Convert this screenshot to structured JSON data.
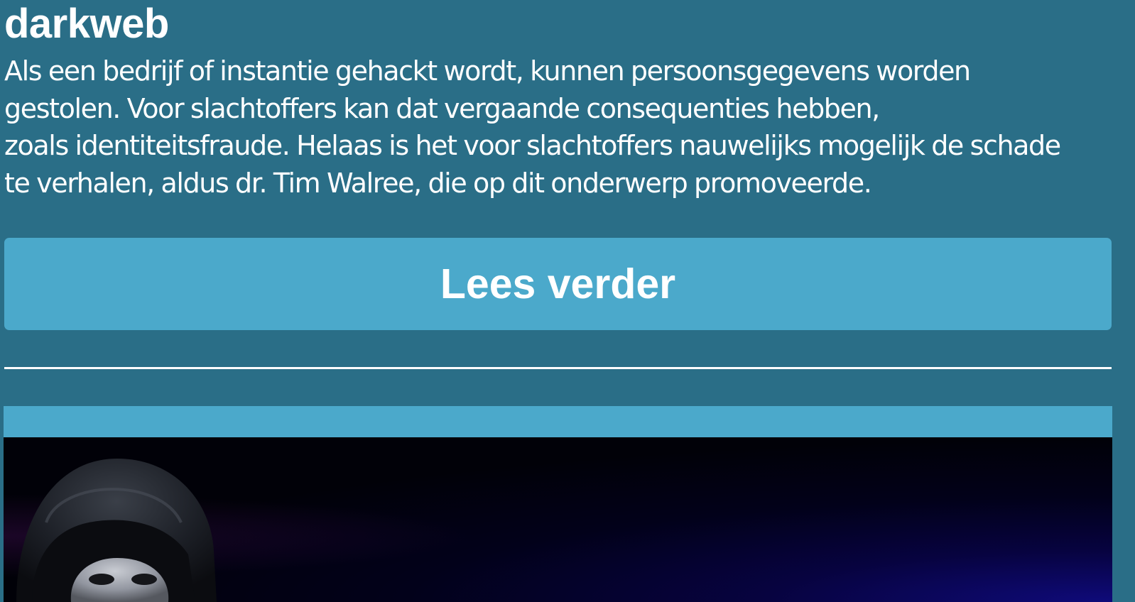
{
  "article": {
    "title": "darkweb",
    "lines": [
      "Als een bedrijf of instantie gehackt wordt, kunnen persoonsgegevens worden",
      "gestolen. Voor slachtoffers kan dat vergaande consequenties hebben,",
      "zoals identiteitsfraude. Helaas is het voor slachtoffers nauwelijks mogelijk de schade",
      "te verhalen, aldus dr. Tim Walree, die op dit onderwerp promoveerde."
    ],
    "read_more_label": "Lees verder"
  },
  "colors": {
    "page_background": "#2a6e87",
    "button_background": "#4ba9cb",
    "text": "#ffffff"
  },
  "next_card": {
    "image_icon": "hooded-masked-hacker-image"
  }
}
